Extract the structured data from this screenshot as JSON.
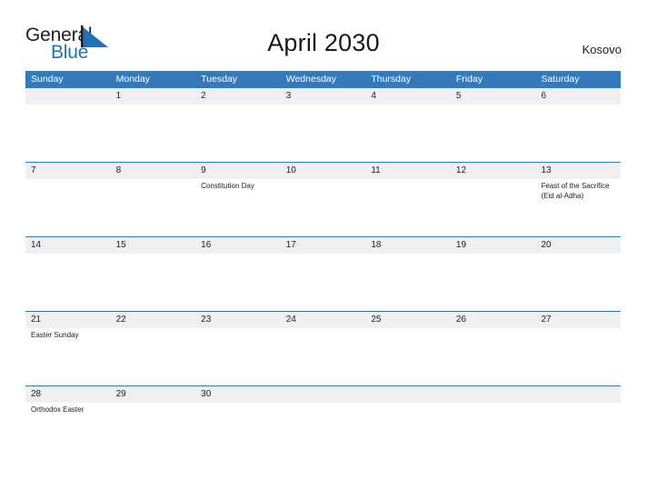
{
  "logo": {
    "text_top": "General",
    "text_bottom": "Blue",
    "triangle_icon": "blue-triangle-icon",
    "color_dark": "#231f20",
    "color_blue": "#2272b9"
  },
  "header": {
    "title": "April 2030",
    "locale": "Kosovo"
  },
  "theme": {
    "header_blue": "#3479bc",
    "band_gray": "#f0f0f0",
    "text": "#222222",
    "background": "#ffffff"
  },
  "calendar": {
    "weekdays": [
      "Sunday",
      "Monday",
      "Tuesday",
      "Wednesday",
      "Thursday",
      "Friday",
      "Saturday"
    ],
    "weeks": [
      [
        {
          "day": "",
          "events": []
        },
        {
          "day": "1",
          "events": []
        },
        {
          "day": "2",
          "events": []
        },
        {
          "day": "3",
          "events": []
        },
        {
          "day": "4",
          "events": []
        },
        {
          "day": "5",
          "events": []
        },
        {
          "day": "6",
          "events": []
        }
      ],
      [
        {
          "day": "7",
          "events": []
        },
        {
          "day": "8",
          "events": []
        },
        {
          "day": "9",
          "events": [
            "Constitution Day"
          ]
        },
        {
          "day": "10",
          "events": []
        },
        {
          "day": "11",
          "events": []
        },
        {
          "day": "12",
          "events": []
        },
        {
          "day": "13",
          "events": [
            "Feast of the Sacrifice (Eid al-Adha)"
          ]
        }
      ],
      [
        {
          "day": "14",
          "events": []
        },
        {
          "day": "15",
          "events": []
        },
        {
          "day": "16",
          "events": []
        },
        {
          "day": "17",
          "events": []
        },
        {
          "day": "18",
          "events": []
        },
        {
          "day": "19",
          "events": []
        },
        {
          "day": "20",
          "events": []
        }
      ],
      [
        {
          "day": "21",
          "events": [
            "Easter Sunday"
          ]
        },
        {
          "day": "22",
          "events": []
        },
        {
          "day": "23",
          "events": []
        },
        {
          "day": "24",
          "events": []
        },
        {
          "day": "25",
          "events": []
        },
        {
          "day": "26",
          "events": []
        },
        {
          "day": "27",
          "events": []
        }
      ],
      [
        {
          "day": "28",
          "events": [
            "Orthodox Easter"
          ]
        },
        {
          "day": "29",
          "events": []
        },
        {
          "day": "30",
          "events": []
        },
        {
          "day": "",
          "events": []
        },
        {
          "day": "",
          "events": []
        },
        {
          "day": "",
          "events": []
        },
        {
          "day": "",
          "events": []
        }
      ]
    ]
  }
}
